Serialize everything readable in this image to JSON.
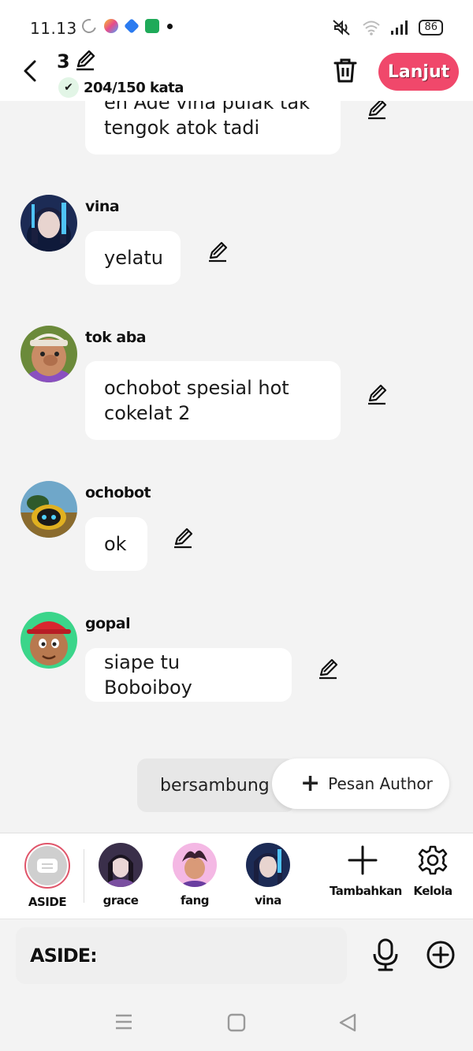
{
  "status_bar": {
    "time": "11.13",
    "battery": "86"
  },
  "header": {
    "chapter_number": "3",
    "word_count": "204/150 kata",
    "next_label": "Lanjut"
  },
  "messages": [
    {
      "speaker": "",
      "text_lines": [
        "eh Ade vina pulak tak",
        "tengok atok tadi"
      ]
    },
    {
      "speaker": "vina",
      "text_lines": [
        "yelatu"
      ]
    },
    {
      "speaker": "tok aba",
      "text_lines": [
        "ochobot spesial hot",
        "cokelat 2"
      ]
    },
    {
      "speaker": "ochobot",
      "text_lines": [
        "ok"
      ]
    },
    {
      "speaker": "gopal",
      "text_lines": [
        "siape tu Boboiboy"
      ]
    }
  ],
  "continued_label": "bersambung",
  "author_message_label": "Pesan Author",
  "characters": [
    {
      "name": "ASIDE"
    },
    {
      "name": "grace"
    },
    {
      "name": "fang"
    },
    {
      "name": "vina"
    }
  ],
  "tools": {
    "add_label": "Tambahkan",
    "manage_label": "Kelola"
  },
  "input": {
    "placeholder": "ASIDE:"
  },
  "colors": {
    "accent": "#f0486b",
    "background": "#f3f3f3",
    "bubble": "#ffffff"
  }
}
